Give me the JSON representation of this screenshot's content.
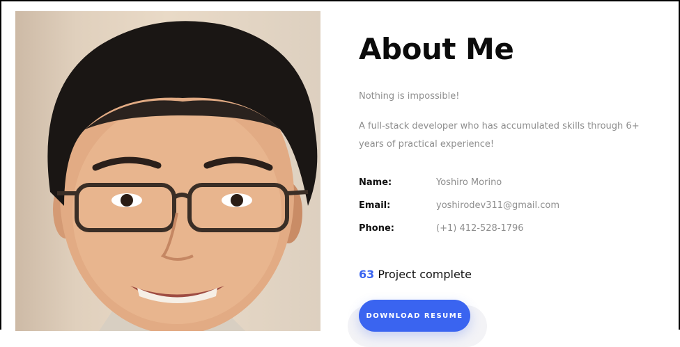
{
  "about": {
    "title": "About Me",
    "tagline": "Nothing is impossible!",
    "description": "A full-stack developer who has accumulated skills through 6+ years of practical experience!",
    "info": [
      {
        "label": "Name:",
        "value": "Yoshiro Morino"
      },
      {
        "label": "Email:",
        "value": "yoshirodev311@gmail.com"
      },
      {
        "label": "Phone:",
        "value": "(+1) 412-528-1796"
      }
    ],
    "stat": {
      "number": "63",
      "text": "Project complete"
    },
    "button_label": "Download Resume"
  },
  "colors": {
    "accent": "#3a64f0",
    "heading": "#0b0b0b",
    "muted": "#8e8e8e"
  },
  "photo": {
    "icon": "portrait-photo"
  }
}
